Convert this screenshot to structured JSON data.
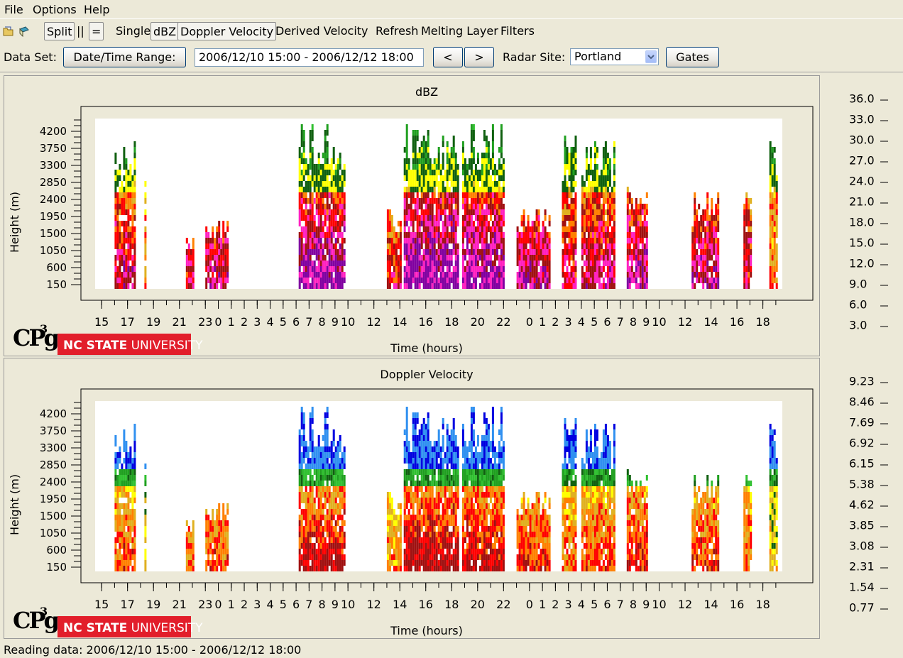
{
  "menu": [
    "File",
    "Options",
    "Help"
  ],
  "toolbar": {
    "icons": [
      "open-icon",
      "save-icon"
    ],
    "split": "Split",
    "parallel": "||",
    "equal": "=",
    "single": "Single",
    "dbz": "dBZ",
    "doppler": "Doppler Velocity",
    "derived": "Derived Velocity",
    "refresh": "Refresh",
    "melting": "Melting Layer",
    "filters": "Filters"
  },
  "dataset": {
    "label": "Data Set:",
    "range_button": "Date/Time Range:",
    "range_value": "2006/12/10 15:00 - 2006/12/12 18:00",
    "prev": "<",
    "next": ">",
    "site_label": "Radar Site:",
    "site_value": "Portland",
    "gates": "Gates"
  },
  "logo": {
    "cpg": "CPg",
    "cpg_sup": "3",
    "university_bold": "NC STATE",
    "university_rest": " UNIVERSITY"
  },
  "status": "Reading data: 2006/12/10 15:00 - 2006/12/12 18:00",
  "colors": {
    "bg": "#ece9d8",
    "scale": [
      "#30d0d0",
      "#3090f0",
      "#0000e0",
      "#30c030",
      "#20a020",
      "#106010",
      "#ffff00",
      "#e0b020",
      "#ff8000",
      "#ff0000",
      "#a01010",
      "#ff20c0",
      "#8000a0"
    ]
  },
  "chart_data": [
    {
      "type": "heatmap",
      "title": "dBZ",
      "xlabel": "Time (hours)",
      "ylabel": "Height (m)",
      "x_ticks": [
        "15",
        "17",
        "19",
        "21",
        "23",
        "0",
        "1",
        "2",
        "3",
        "4",
        "5",
        "6",
        "7",
        "8",
        "9",
        "10",
        "12",
        "14",
        "16",
        "18",
        "20",
        "22",
        "0",
        "1",
        "2",
        "3",
        "4",
        "5",
        "6",
        "7",
        "8",
        "9",
        "10",
        "12",
        "14",
        "16",
        "18"
      ],
      "y_ticks": [
        "150",
        "600",
        "1050",
        "1500",
        "1950",
        "2400",
        "2850",
        "3300",
        "3750",
        "4200"
      ],
      "scale_labels": [
        "3.0",
        "6.0",
        "9.0",
        "12.0",
        "15.0",
        "18.0",
        "21.0",
        "24.0",
        "27.0",
        "30.0",
        "33.0",
        "36.0"
      ],
      "echo_periods_hours": [
        [
          16,
          17.5
        ],
        [
          21.5,
          22
        ],
        [
          23,
          24.8
        ],
        [
          30.2,
          33.8
        ],
        [
          37,
          38
        ],
        [
          38.3,
          42.5
        ],
        [
          42.8,
          46
        ],
        [
          47,
          49.5
        ],
        [
          50.5,
          51.5
        ],
        [
          52,
          54.5
        ],
        [
          55.5,
          57
        ],
        [
          60.5,
          62.5
        ],
        [
          64.5,
          65
        ],
        [
          66.5,
          67
        ]
      ]
    },
    {
      "type": "heatmap",
      "title": "Doppler Velocity",
      "xlabel": "Time (hours)",
      "ylabel": "Height (m)",
      "x_ticks": [
        "15",
        "17",
        "19",
        "21",
        "23",
        "0",
        "1",
        "2",
        "3",
        "4",
        "5",
        "6",
        "7",
        "8",
        "9",
        "10",
        "12",
        "14",
        "16",
        "18",
        "20",
        "22",
        "0",
        "1",
        "2",
        "3",
        "4",
        "5",
        "6",
        "7",
        "8",
        "9",
        "10",
        "12",
        "14",
        "16",
        "18"
      ],
      "y_ticks": [
        "150",
        "600",
        "1050",
        "1500",
        "1950",
        "2400",
        "2850",
        "3300",
        "3750",
        "4200"
      ],
      "scale_labels": [
        "0.77",
        "1.54",
        "2.31",
        "3.08",
        "3.85",
        "4.62",
        "5.38",
        "6.15",
        "6.92",
        "7.69",
        "8.46",
        "9.23"
      ]
    }
  ]
}
